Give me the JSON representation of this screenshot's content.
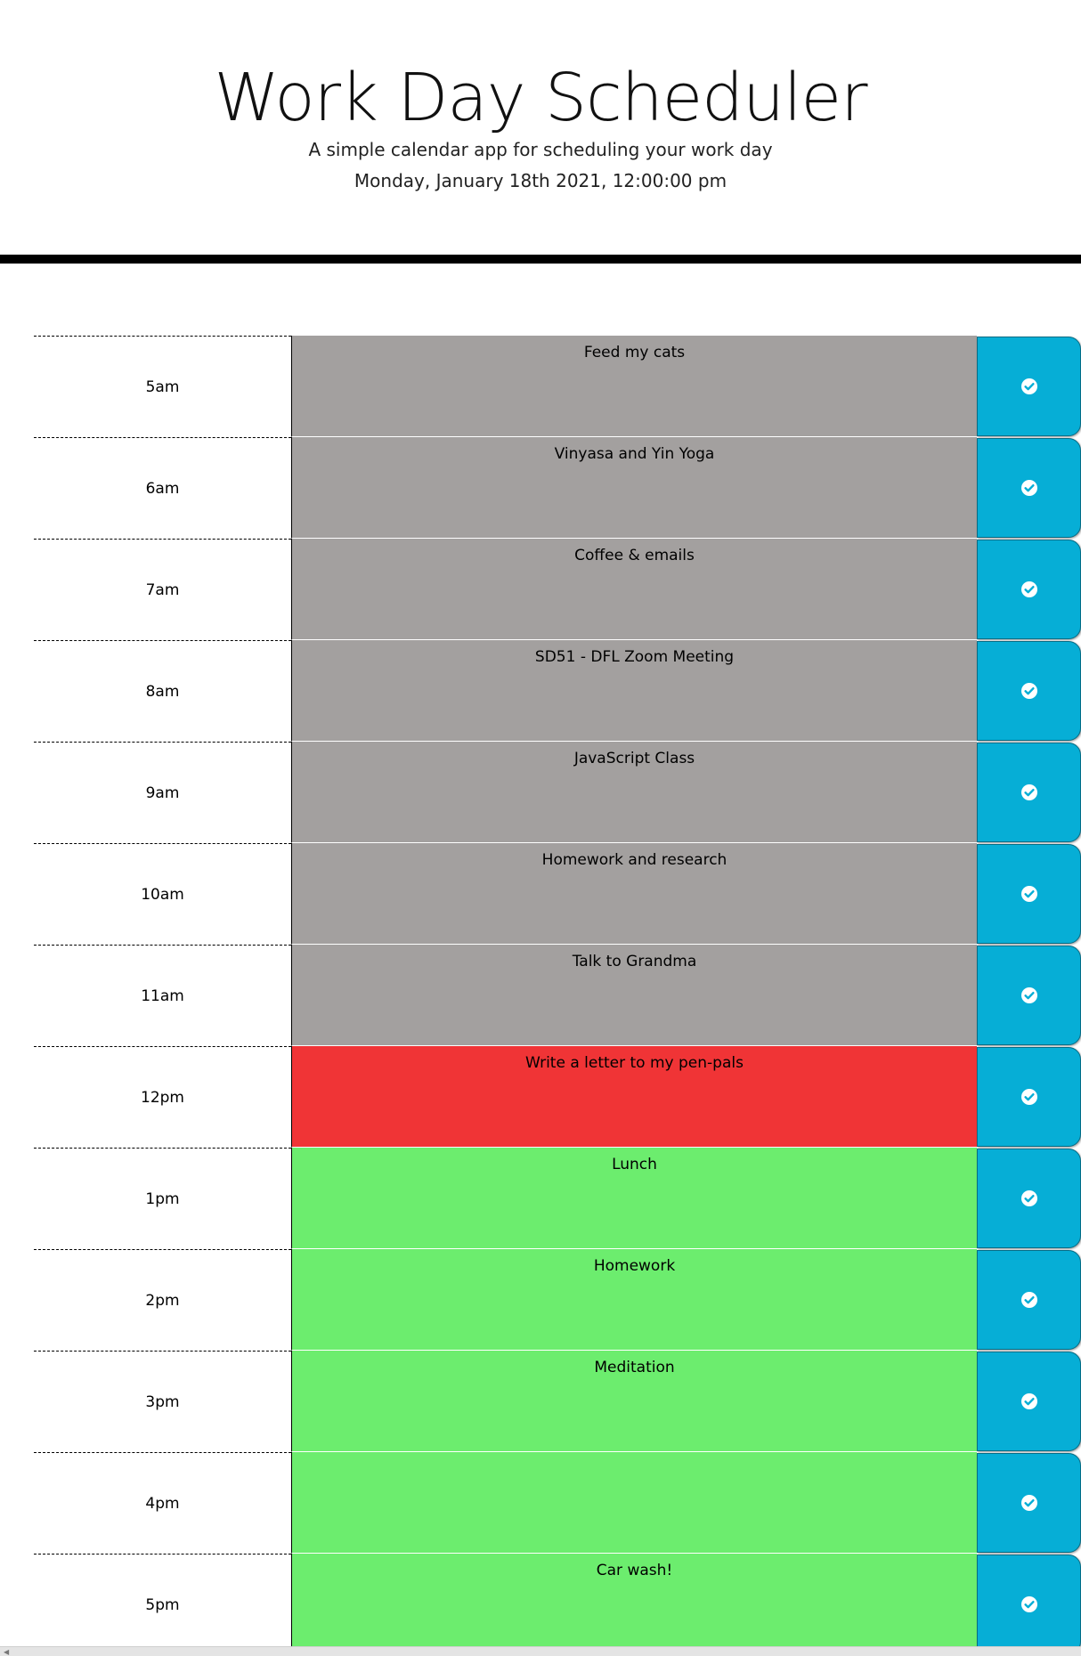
{
  "header": {
    "title": "Work Day Scheduler",
    "subtitle": "A simple calendar app for scheduling your work day",
    "current_day": "Monday, January 18th 2021, 12:00:00 pm"
  },
  "colors": {
    "past": "#a3a09f",
    "present": "#f03436",
    "future": "#6ced6e",
    "save_button": "#06aed6"
  },
  "save_icon": "check-circle-icon",
  "rows": [
    {
      "hour": "5am",
      "text": "Feed my cats",
      "state": "past"
    },
    {
      "hour": "6am",
      "text": "Vinyasa and Yin Yoga",
      "state": "past"
    },
    {
      "hour": "7am",
      "text": "Coffee & emails",
      "state": "past"
    },
    {
      "hour": "8am",
      "text": "SD51 - DFL Zoom Meeting",
      "state": "past"
    },
    {
      "hour": "9am",
      "text": "JavaScript Class",
      "state": "past"
    },
    {
      "hour": "10am",
      "text": "Homework and research",
      "state": "past"
    },
    {
      "hour": "11am",
      "text": "Talk to Grandma",
      "state": "past"
    },
    {
      "hour": "12pm",
      "text": "Write a letter to my pen-pals",
      "state": "present"
    },
    {
      "hour": "1pm",
      "text": "Lunch",
      "state": "future"
    },
    {
      "hour": "2pm",
      "text": "Homework",
      "state": "future"
    },
    {
      "hour": "3pm",
      "text": "Meditation",
      "state": "future"
    },
    {
      "hour": "4pm",
      "text": "",
      "state": "future"
    },
    {
      "hour": "5pm",
      "text": "Car wash!",
      "state": "future"
    }
  ]
}
